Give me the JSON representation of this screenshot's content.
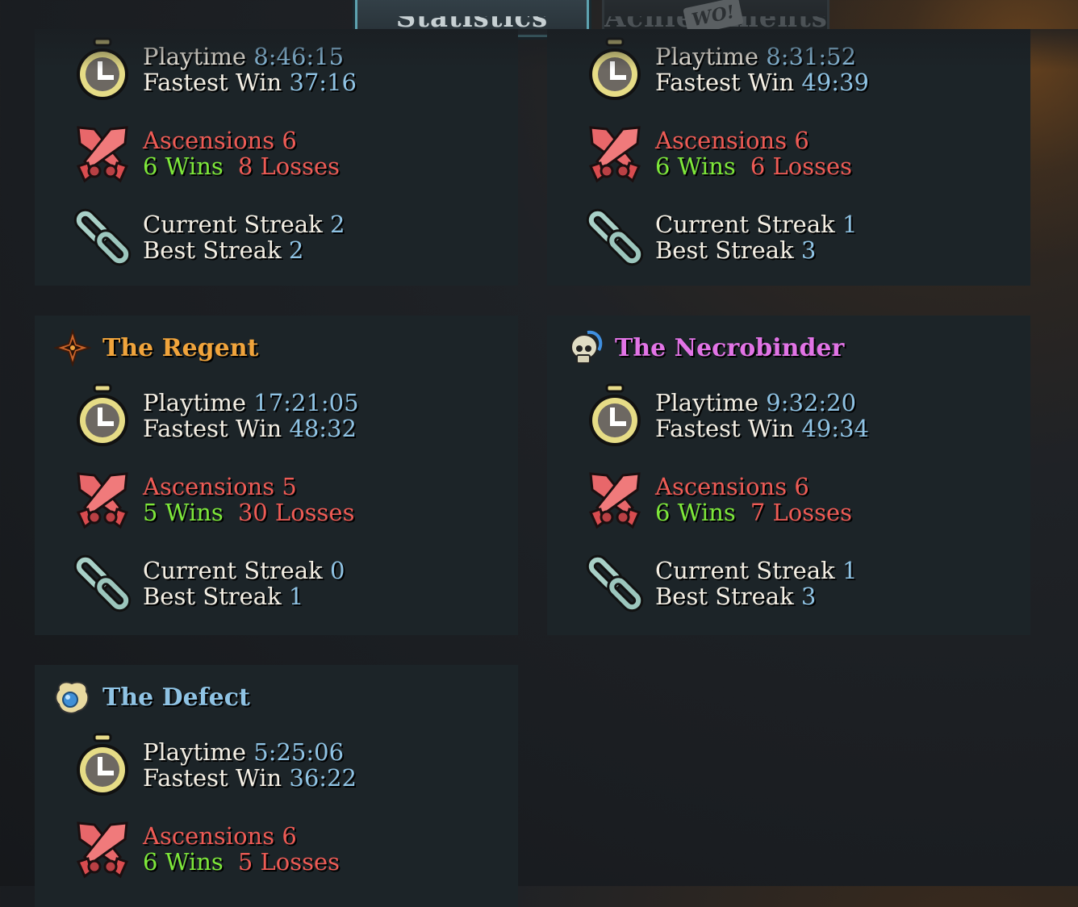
{
  "tabs": {
    "statistics": "Statistics",
    "achievements": "Achievements",
    "overlay_stamp": "WO!"
  },
  "colors": {
    "ironclad": "#ee5b55",
    "regent": "#f0a43c",
    "necrobinder": "#e274e6",
    "defect": "#8fc3e4",
    "value": "#8fc3e4",
    "wins": "#7ee83a",
    "losses": "#ee5b55"
  },
  "characters": [
    {
      "name": "",
      "icon": "",
      "playtime_label": "Playtime",
      "playtime": "8:46:15",
      "fastest_label": "Fastest Win",
      "fastest": "37:16",
      "ascensions_label": "Ascensions",
      "ascensions": "6",
      "wins": "6 Wins",
      "losses": "8 Losses",
      "current_streak_label": "Current Streak",
      "current_streak": "2",
      "best_streak_label": "Best Streak",
      "best_streak": "2"
    },
    {
      "name": "",
      "icon": "",
      "playtime_label": "Playtime",
      "playtime": "8:31:52",
      "fastest_label": "Fastest Win",
      "fastest": "49:39",
      "ascensions_label": "Ascensions",
      "ascensions": "6",
      "wins": "6 Wins",
      "losses": "6 Losses",
      "current_streak_label": "Current Streak",
      "current_streak": "1",
      "best_streak_label": "Best Streak",
      "best_streak": "3"
    },
    {
      "name": "The Regent",
      "icon": "regent-star-icon",
      "playtime_label": "Playtime",
      "playtime": "17:21:05",
      "fastest_label": "Fastest Win",
      "fastest": "48:32",
      "ascensions_label": "Ascensions",
      "ascensions": "5",
      "wins": "5 Wins",
      "losses": "30 Losses",
      "current_streak_label": "Current Streak",
      "current_streak": "0",
      "best_streak_label": "Best Streak",
      "best_streak": "1"
    },
    {
      "name": "The Necrobinder",
      "icon": "skull-icon",
      "playtime_label": "Playtime",
      "playtime": "9:32:20",
      "fastest_label": "Fastest Win",
      "fastest": "49:34",
      "ascensions_label": "Ascensions",
      "ascensions": "6",
      "wins": "6 Wins",
      "losses": "7 Losses",
      "current_streak_label": "Current Streak",
      "current_streak": "1",
      "best_streak_label": "Best Streak",
      "best_streak": "3"
    },
    {
      "name": "The Defect",
      "icon": "orb-icon",
      "playtime_label": "Playtime",
      "playtime": "5:25:06",
      "fastest_label": "Fastest Win",
      "fastest": "36:22",
      "ascensions_label": "Ascensions",
      "ascensions": "6",
      "wins": "6 Wins",
      "losses": "5 Losses"
    }
  ]
}
